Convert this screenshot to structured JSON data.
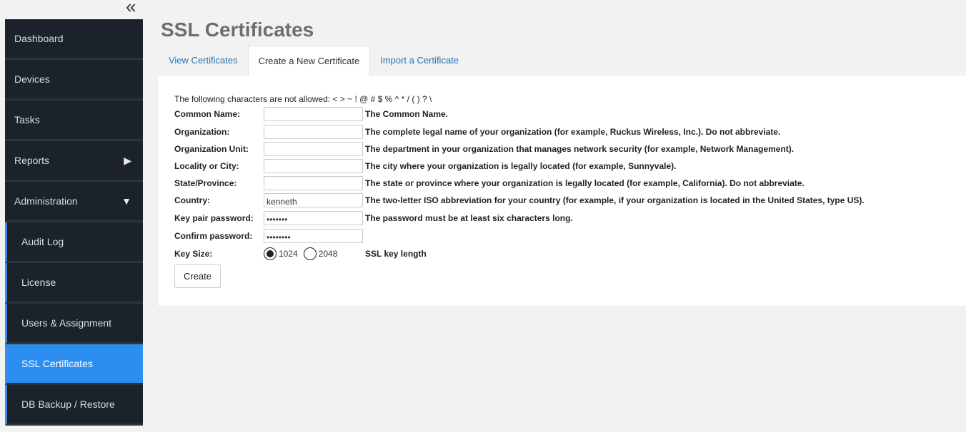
{
  "sidebar": {
    "collapse_icon": "«",
    "items": [
      {
        "label": "Dashboard"
      },
      {
        "label": "Devices"
      },
      {
        "label": "Tasks"
      },
      {
        "label": "Reports",
        "arrow": "▶"
      },
      {
        "label": "Administration",
        "arrow": "▼"
      }
    ],
    "sub_items": [
      {
        "label": "Audit Log"
      },
      {
        "label": "License"
      },
      {
        "label": "Users & Assignment"
      },
      {
        "label": "SSL Certificates"
      },
      {
        "label": "DB Backup / Restore"
      }
    ]
  },
  "page": {
    "title": "SSL Certificates"
  },
  "tabs": [
    {
      "label": "View Certificates"
    },
    {
      "label": "Create a New Certificate"
    },
    {
      "label": "Import a Certificate"
    }
  ],
  "form": {
    "notice": "The following characters are not allowed: < > ~ ! @ # $ % ^ * / ( ) ? \\",
    "fields": [
      {
        "label": "Common Name:",
        "value": "",
        "desc": "The Common Name."
      },
      {
        "label": "Organization:",
        "value": "",
        "desc": "The complete legal name of your organization (for example, Ruckus Wireless, Inc.). Do not abbreviate."
      },
      {
        "label": "Organization Unit:",
        "value": "",
        "desc": "The department in your organization that manages network security (for example, Network Management)."
      },
      {
        "label": "Locality or City:",
        "value": "",
        "desc": "The city where your organization is legally located (for example, Sunnyvale)."
      },
      {
        "label": "State/Province:",
        "value": "",
        "desc": "The state or province where your organization is legally located (for example, California). Do not abbreviate."
      },
      {
        "label": "Country:",
        "value": "kenneth",
        "desc": "The two-letter ISO abbreviation for your country (for example, if your organization is located in the United States, type US)."
      },
      {
        "label": "Key pair password:",
        "value": "•••••••",
        "desc": "The password must be at least six characters long."
      },
      {
        "label": "Confirm password:",
        "value": "••••••••",
        "desc": ""
      }
    ],
    "key_size": {
      "label": "Key Size:",
      "options": [
        "1024",
        "2048"
      ],
      "selected": "1024",
      "desc": "SSL key length"
    },
    "create_label": "Create"
  }
}
